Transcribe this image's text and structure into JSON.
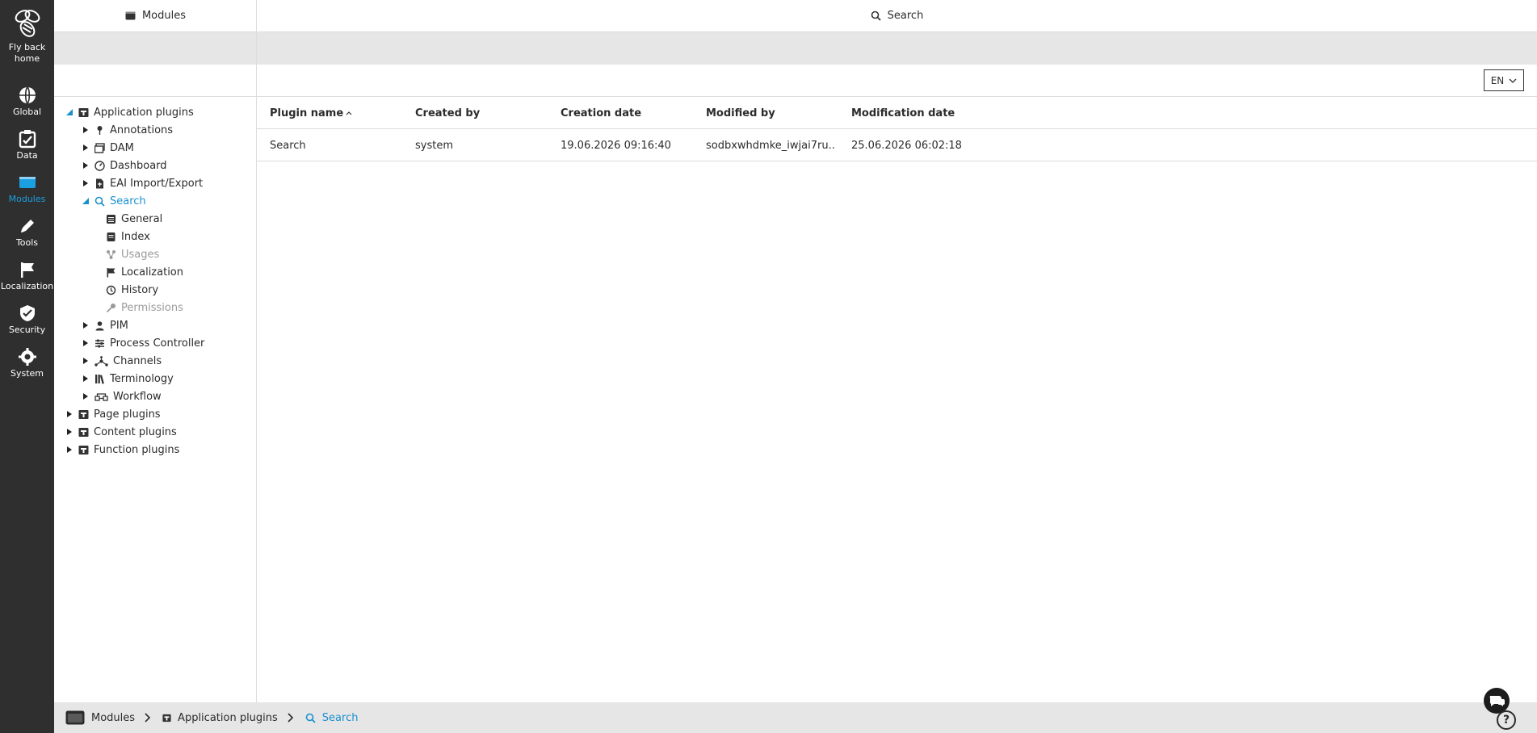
{
  "rail": {
    "home_label": "Fly back home",
    "items": [
      {
        "label": "Global",
        "icon": "globe-icon"
      },
      {
        "label": "Data",
        "icon": "data-icon"
      },
      {
        "label": "Modules",
        "icon": "modules-icon",
        "active": true
      },
      {
        "label": "Tools",
        "icon": "pencil-icon"
      },
      {
        "label": "Localization",
        "icon": "flag-icon"
      },
      {
        "label": "Security",
        "icon": "shield-icon"
      },
      {
        "label": "System",
        "icon": "gear-icon"
      }
    ],
    "active_color": "#1a9fe0"
  },
  "tree_pane": {
    "title": "Modules",
    "nodes": [
      {
        "label": "Application plugins",
        "icon": "plugin-icon",
        "expanded": true
      },
      {
        "label": "Annotations",
        "icon": "pin-icon"
      },
      {
        "label": "DAM",
        "icon": "dam-icon"
      },
      {
        "label": "Dashboard",
        "icon": "dashboard-icon"
      },
      {
        "label": "EAI Import/Export",
        "icon": "file-icon"
      },
      {
        "label": "Search",
        "icon": "search-icon",
        "selected": true,
        "expanded": true
      },
      {
        "label": "General",
        "icon": "general-icon"
      },
      {
        "label": "Index",
        "icon": "index-icon"
      },
      {
        "label": "Usages",
        "icon": "usages-icon",
        "disabled": true
      },
      {
        "label": "Localization",
        "icon": "flag-icon"
      },
      {
        "label": "History",
        "icon": "history-icon"
      },
      {
        "label": "Permissions",
        "icon": "key-icon",
        "disabled": true
      },
      {
        "label": "PIM",
        "icon": "pim-icon"
      },
      {
        "label": "Process Controller",
        "icon": "process-icon"
      },
      {
        "label": "Channels",
        "icon": "channels-icon"
      },
      {
        "label": "Terminology",
        "icon": "terminology-icon"
      },
      {
        "label": "Workflow",
        "icon": "workflow-icon"
      },
      {
        "label": "Page plugins",
        "icon": "plugin-icon"
      },
      {
        "label": "Content plugins",
        "icon": "plugin-icon"
      },
      {
        "label": "Function plugins",
        "icon": "plugin-icon"
      }
    ]
  },
  "main": {
    "title": "Search",
    "language": "EN",
    "columns": [
      "Plugin name",
      "Created by",
      "Creation date",
      "Modified by",
      "Modification date"
    ],
    "rows": [
      [
        "Search",
        "system",
        "19.06.2026 09:16:40",
        "sodbxwhdmke_iwjai7ru...",
        "25.06.2026 06:02:18"
      ]
    ]
  },
  "breadcrumb": [
    "Modules",
    "Application plugins",
    "Search"
  ],
  "help_label": "?"
}
